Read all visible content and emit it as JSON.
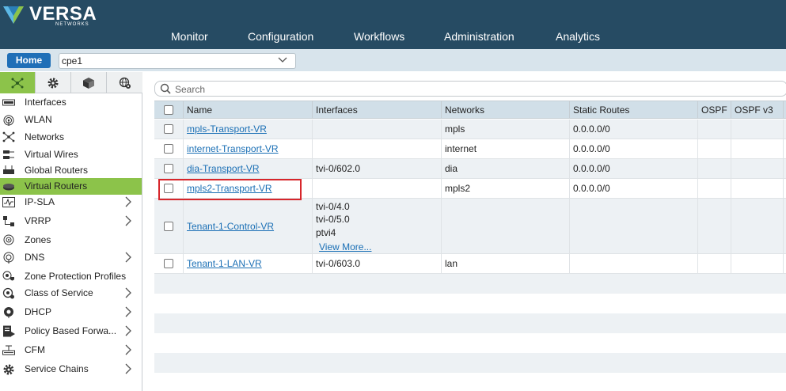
{
  "brand": {
    "name": "VERSA",
    "sub": "NETWORKS"
  },
  "nav": [
    "Monitor",
    "Configuration",
    "Workflows",
    "Administration",
    "Analytics"
  ],
  "breadcrumb": {
    "home": "Home",
    "device": "cpe1"
  },
  "sidebar": {
    "tabs": [
      "networking-icon",
      "gear-icon",
      "cube-icon",
      "globe-gear-icon"
    ],
    "items": [
      {
        "label": "Interfaces",
        "icon": "interface-icon",
        "arrow": false
      },
      {
        "label": "WLAN",
        "icon": "wifi-icon",
        "arrow": false
      },
      {
        "label": "Networks",
        "icon": "network-icon",
        "arrow": false
      },
      {
        "label": "Virtual Wires",
        "icon": "wire-icon",
        "arrow": false
      },
      {
        "label": "Global Routers",
        "icon": "router-icon",
        "arrow": false
      },
      {
        "label": "Virtual Routers",
        "icon": "virtual-router-icon",
        "arrow": false,
        "active": true
      },
      {
        "label": "IP-SLA",
        "icon": "sla-icon",
        "arrow": true
      },
      {
        "label": "VRRP",
        "icon": "vrrp-icon",
        "arrow": true
      },
      {
        "label": "Zones",
        "icon": "zone-icon",
        "arrow": false
      },
      {
        "label": "DNS",
        "icon": "dns-icon",
        "arrow": true
      },
      {
        "label": "Zone Protection Profiles",
        "icon": "zone-protection-icon",
        "arrow": false
      },
      {
        "label": "Class of Service",
        "icon": "cos-icon",
        "arrow": true
      },
      {
        "label": "DHCP",
        "icon": "dhcp-icon",
        "arrow": true
      },
      {
        "label": "Policy Based Forwa...",
        "icon": "policy-icon",
        "arrow": true
      },
      {
        "label": "CFM",
        "icon": "cfm-icon",
        "arrow": true
      },
      {
        "label": "Service Chains",
        "icon": "service-chain-icon",
        "arrow": true
      }
    ]
  },
  "search": {
    "placeholder": "Search"
  },
  "table": {
    "columns": [
      "Name",
      "Interfaces",
      "Networks",
      "Static Routes",
      "OSPF",
      "OSPF v3"
    ],
    "rows": [
      {
        "name": "mpls-Transport-VR",
        "interfaces": [],
        "networks": "mpls",
        "static": "0.0.0.0/0"
      },
      {
        "name": "internet-Transport-VR",
        "interfaces": [],
        "networks": "internet",
        "static": "0.0.0.0/0"
      },
      {
        "name": "dia-Transport-VR",
        "interfaces": [
          "tvi-0/602.0"
        ],
        "networks": "dia",
        "static": "0.0.0.0/0"
      },
      {
        "name": "mpls2-Transport-VR",
        "interfaces": [],
        "networks": "mpls2",
        "static": "0.0.0.0/0"
      },
      {
        "name": "Tenant-1-Control-VR",
        "interfaces": [
          "tvi-0/4.0",
          "tvi-0/5.0",
          "ptvi4"
        ],
        "view_more": "View More...",
        "networks": "",
        "static": ""
      },
      {
        "name": "Tenant-1-LAN-VR",
        "interfaces": [
          "tvi-0/603.0"
        ],
        "networks": "lan",
        "static": ""
      }
    ]
  },
  "colors": {
    "header": "#264b63",
    "accent": "#8cc34a",
    "link": "#1a6fb5",
    "highlight": "#d7262b"
  }
}
